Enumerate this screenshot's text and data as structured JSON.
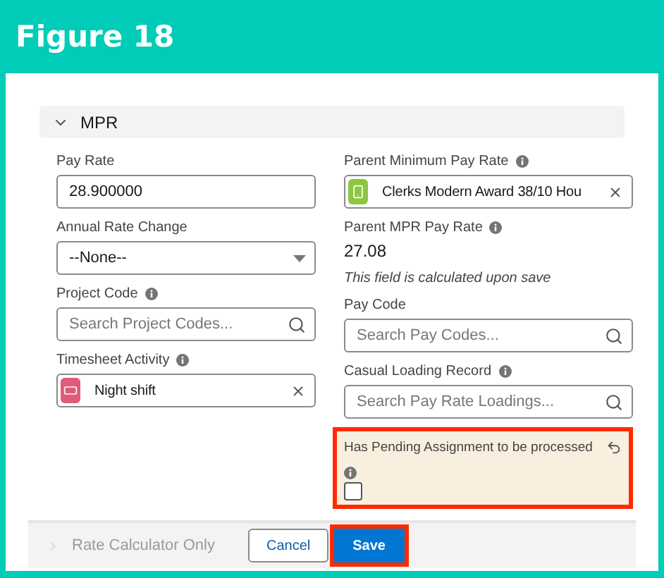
{
  "header": {
    "title": "Figure 18"
  },
  "section": {
    "title": "MPR",
    "expanded": true
  },
  "left_fields": [
    {
      "kind": "text",
      "label": "Pay Rate",
      "info": false,
      "value": "28.900000"
    },
    {
      "kind": "select",
      "label": "Annual Rate Change",
      "info": false,
      "value": "--None--"
    },
    {
      "kind": "lookup",
      "label": "Project Code",
      "info": true,
      "placeholder": "Search Project Codes..."
    },
    {
      "kind": "record",
      "label": "Timesheet Activity",
      "info": true,
      "value": "Night shift",
      "color": "#e05a7a"
    }
  ],
  "right_fields": [
    {
      "kind": "record",
      "label": "Parent Minimum Pay Rate",
      "info": true,
      "value": "Clerks Modern Award 38/10 Hou",
      "color": "#8cc63f"
    },
    {
      "kind": "readonly",
      "label": "Parent MPR Pay Rate",
      "info": true,
      "value": "27.08",
      "note": "This field is calculated upon save"
    },
    {
      "kind": "lookup",
      "label": "Pay Code",
      "info": false,
      "placeholder": "Search Pay Codes..."
    },
    {
      "kind": "lookup",
      "label": "Casual Loading Record",
      "info": true,
      "placeholder": "Search Pay Rate Loadings..."
    },
    {
      "kind": "checkbox",
      "label": "Has Pending Assignment to be processed",
      "info": true,
      "checked": false,
      "edited": true,
      "highlighted": true
    }
  ],
  "footer": {
    "collapsed_section": {
      "title": "Rate Calculator Only",
      "expanded": false
    },
    "buttons": [
      {
        "label": "Cancel",
        "kind": "neutral",
        "highlighted": false
      },
      {
        "label": "Save",
        "kind": "brand",
        "highlighted": true
      }
    ]
  }
}
